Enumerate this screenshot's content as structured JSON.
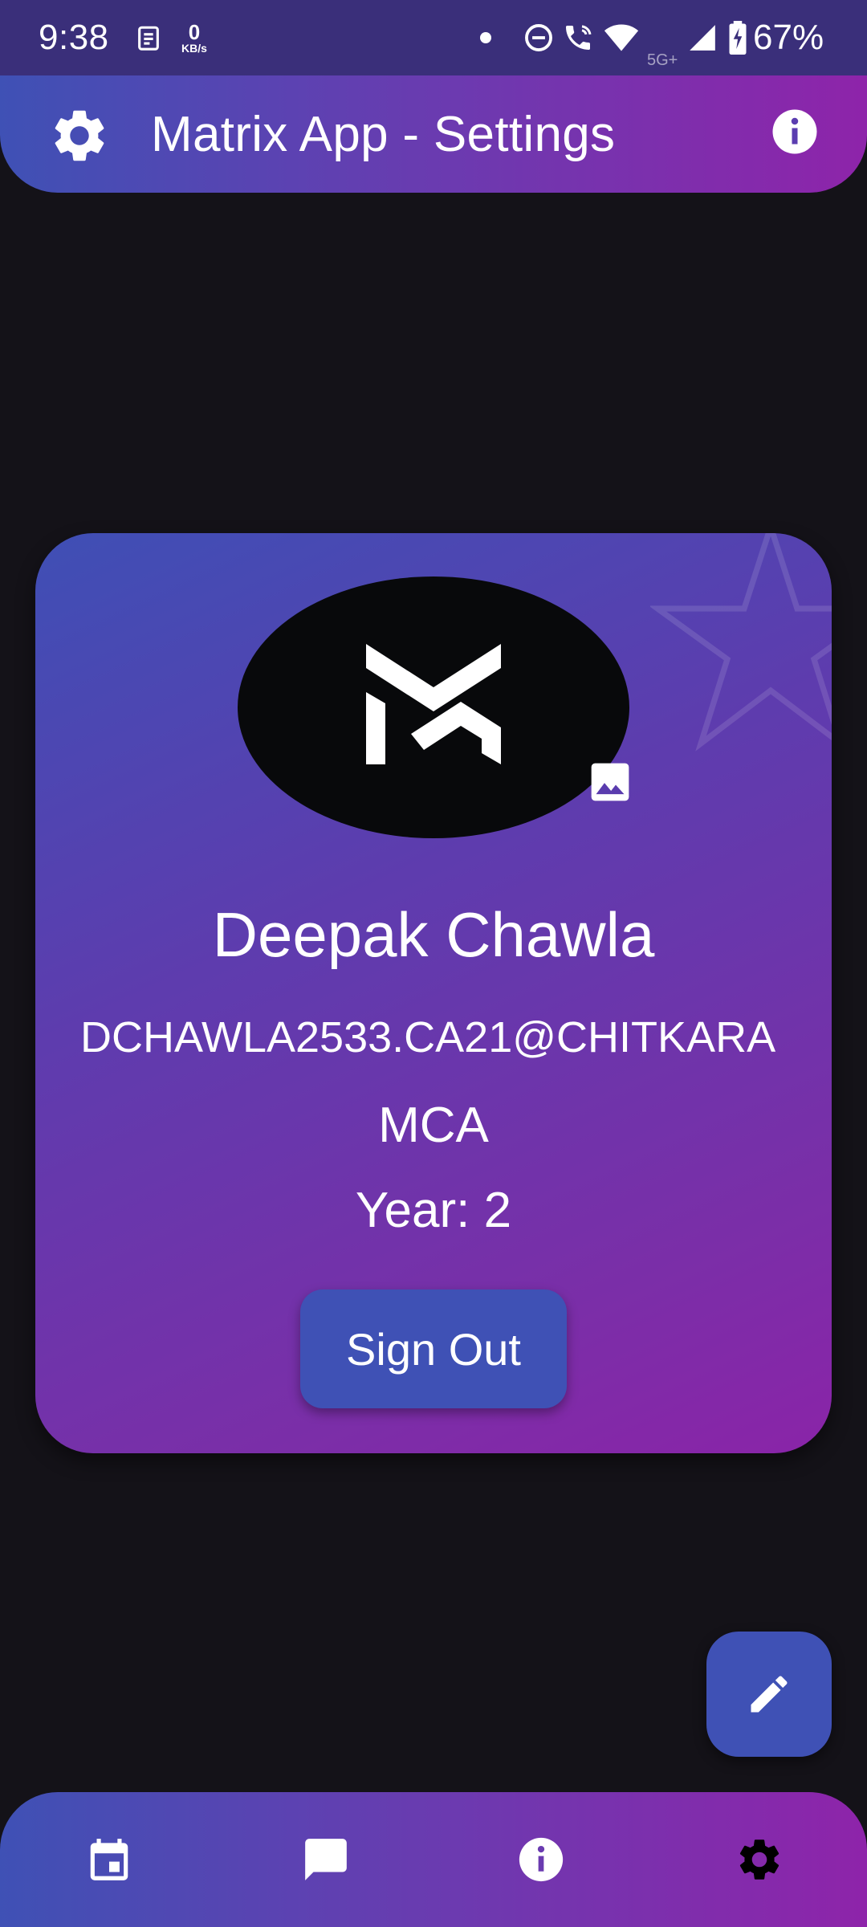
{
  "status_bar": {
    "time": "9:38",
    "net_speed_value": "0",
    "net_speed_unit": "KB/s",
    "network_type": "5G+",
    "battery_percent": "67%"
  },
  "app_bar": {
    "title": "Matrix App - Settings",
    "leading_icon": "settings-gear-icon",
    "trailing_icon": "info-icon"
  },
  "profile": {
    "name": "Deepak Chawla",
    "email": "DCHAWLA2533.CA21@CHITKARA",
    "course": "MCA",
    "year": "Year: 2",
    "sign_out_label": "Sign Out",
    "avatar_icon": "matrix-logo",
    "change_photo_icon": "image-icon"
  },
  "fab": {
    "icon": "edit-pencil-icon"
  },
  "bottom_nav": {
    "items": [
      {
        "id": "calendar",
        "icon": "calendar-icon"
      },
      {
        "id": "chat",
        "icon": "chat-icon"
      },
      {
        "id": "info",
        "icon": "info-icon"
      },
      {
        "id": "settings",
        "icon": "settings-gear-icon",
        "active": true
      }
    ]
  },
  "colors": {
    "background": "#141218",
    "accent_start": "#3f51b5",
    "accent_end": "#8e24aa",
    "button": "#3f51b5",
    "active_nav_icon": "#000000",
    "inactive_nav_icon": "#ffffff"
  }
}
